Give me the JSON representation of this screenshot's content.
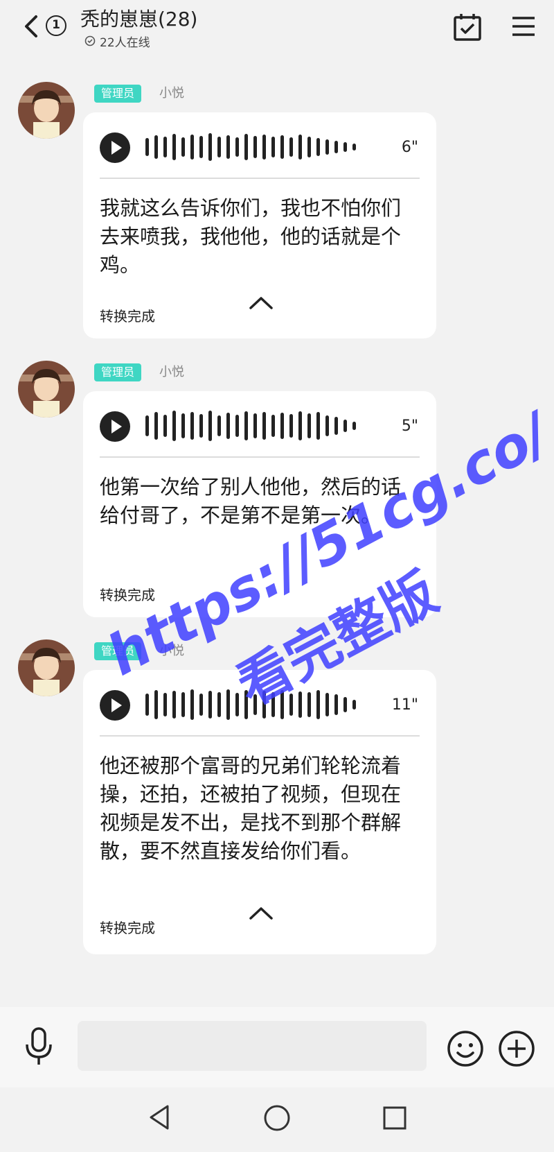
{
  "header": {
    "title": "秃的崽崽(28)",
    "unread_count": "1",
    "online_text": "22人在线"
  },
  "messages": [
    {
      "role_badge": "管理员",
      "nickname": "小悦",
      "duration": "6\"",
      "transcript": "我就这么告诉你们，我也不怕你们去来喷我，我他他，他的话就是个鸡。",
      "status": "转换完成"
    },
    {
      "role_badge": "管理员",
      "nickname": "小悦",
      "duration": "5\"",
      "transcript": "他第一次给了别人他他，然后的话给付哥了，不是第不是第一次。",
      "status": "转换完成"
    },
    {
      "role_badge": "管理员",
      "nickname": "小悦",
      "duration": "11\"",
      "transcript": "他还被那个富哥的兄弟们轮轮流着操，还拍，还被拍了视频，但现在视频是发不出，是找不到那个群解散，要不然直接发给你们看。",
      "status": "转换完成"
    }
  ],
  "input_bar": {
    "placeholder": ""
  },
  "watermark": {
    "line1": "https://51cg.co/",
    "line2": "看完整版"
  },
  "colors": {
    "badge": "#3fd6c3",
    "watermark": "#4040ff",
    "background": "#f2f2f2"
  }
}
